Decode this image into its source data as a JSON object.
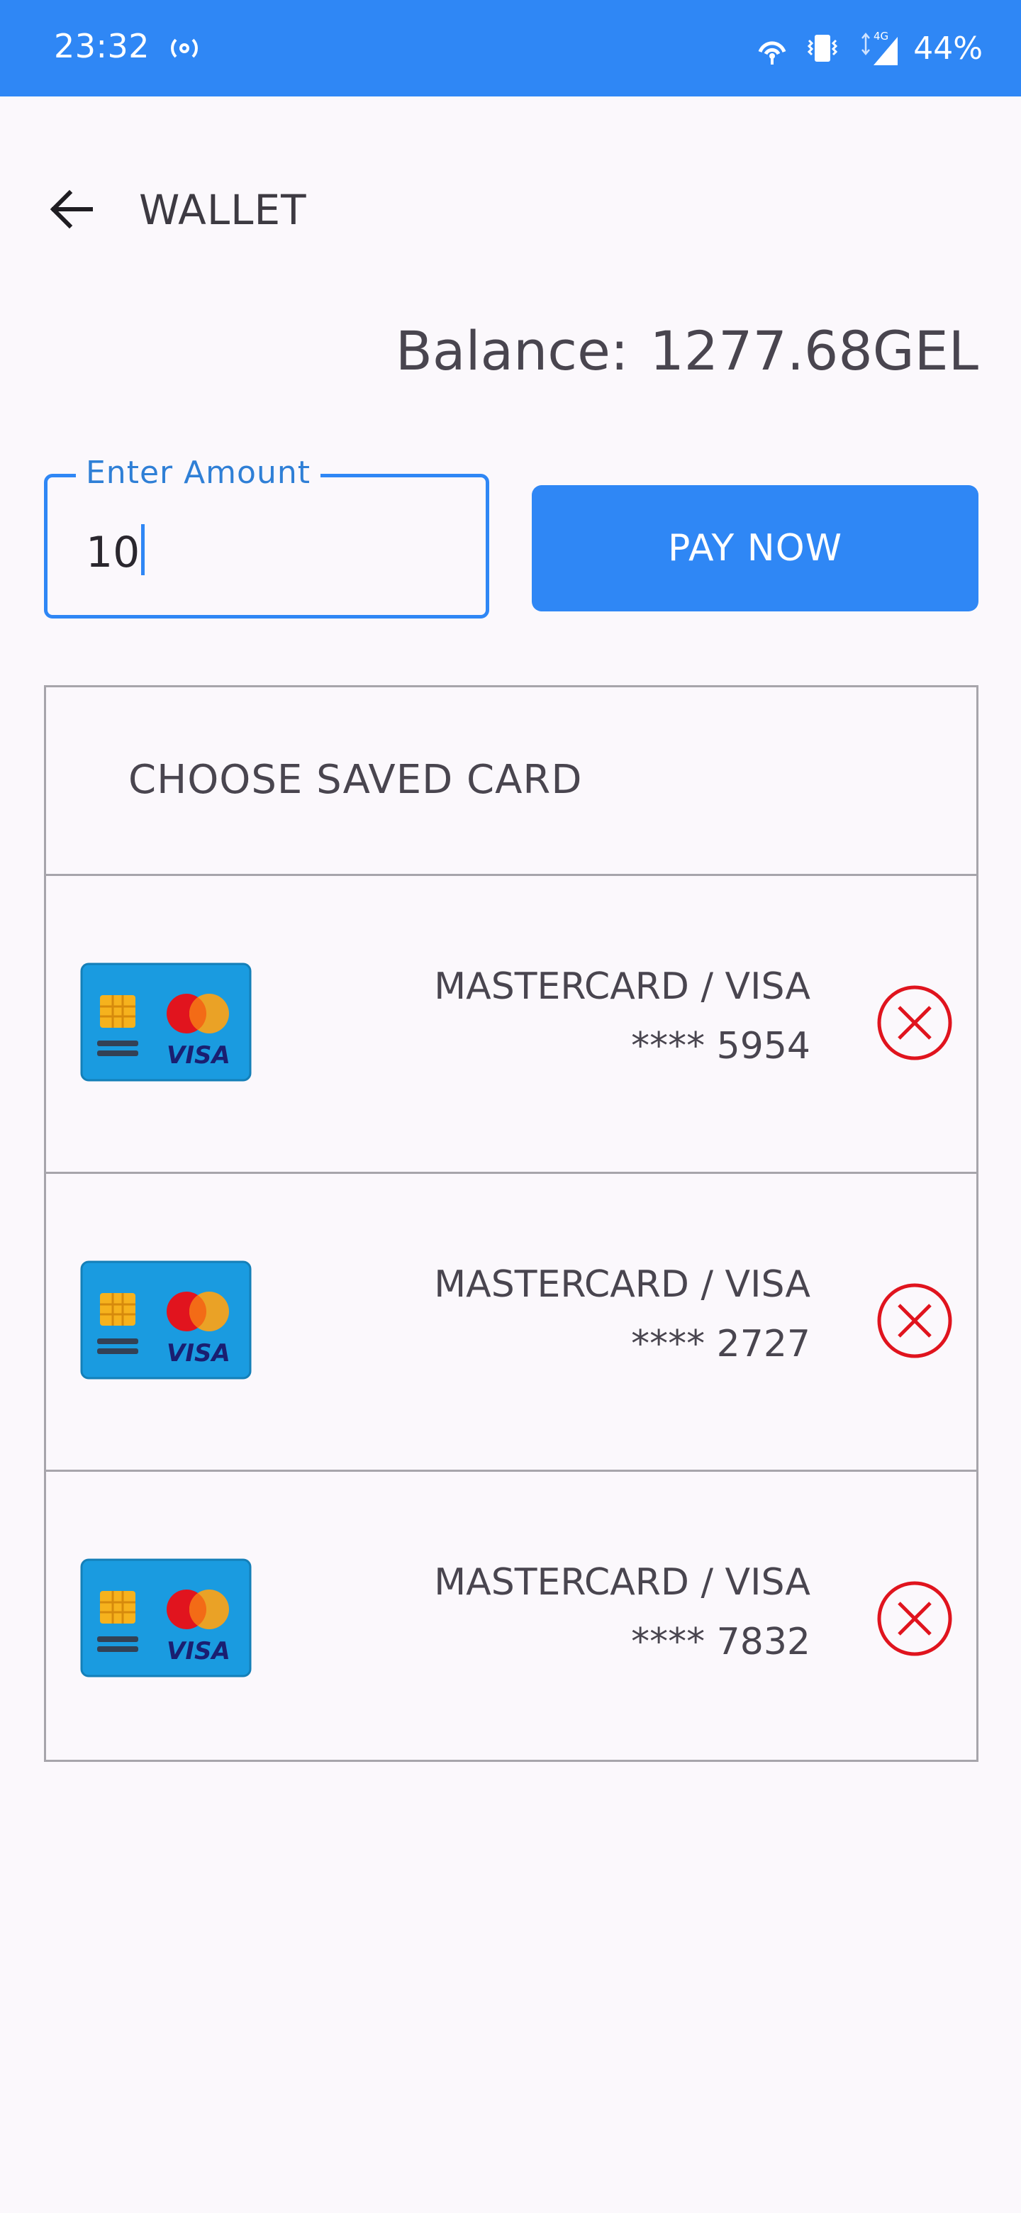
{
  "status_bar": {
    "time": "23:32",
    "battery": "44%",
    "network": "4G"
  },
  "app_bar": {
    "title": "WALLET"
  },
  "balance": {
    "label": "Balance:",
    "value": "1277.68GEL"
  },
  "amount_input": {
    "label": "Enter Amount",
    "value": "10"
  },
  "pay_button": {
    "label": "PAY NOW"
  },
  "saved_cards": {
    "header": "CHOOSE SAVED CARD",
    "items": [
      {
        "type": "MASTERCARD / VISA",
        "number": "**** 5954"
      },
      {
        "type": "MASTERCARD / VISA",
        "number": "**** 2727"
      },
      {
        "type": "MASTERCARD / VISA",
        "number": "**** 7832"
      }
    ]
  },
  "colors": {
    "accent": "#2f87f5",
    "delete": "#e0141e",
    "card": "#1a9be0"
  }
}
